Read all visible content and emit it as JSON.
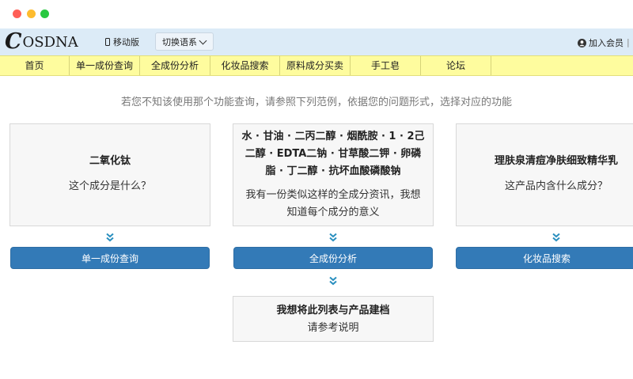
{
  "header": {
    "logo_first": "C",
    "logo_rest": "OSDNA",
    "mobile_label": "移动版",
    "lang_label": "切换语系",
    "join_label": "加入会员",
    "separator": "|"
  },
  "nav": {
    "items": [
      {
        "label": "首页"
      },
      {
        "label": "单一成份查询"
      },
      {
        "label": "全成份分析"
      },
      {
        "label": "化妆品搜索"
      },
      {
        "label": "原料成分买卖"
      },
      {
        "label": "手工皂"
      },
      {
        "label": "论坛"
      }
    ]
  },
  "intro": "若您不知该使用那个功能查询，请参照下列范例，依据您的问题形式，选择对应的功能",
  "cards": {
    "single": {
      "title": "二氧化钛",
      "question": "这个成分是什么？",
      "button": "单一成份查询"
    },
    "full": {
      "title_line1": "水 · 甘油 · 二丙二醇 · 烟酰胺 · 1 · 2己",
      "title_line2": "二醇 · EDTA二钠 · 甘草酸二钾 · 卵磷",
      "title_line3": "脂 · 丁二醇 · 抗坏血酸磷酸钠",
      "question_line1": "我有一份类似这样的全成分资讯，我想",
      "question_line2": "知道每个成分的意义",
      "button": "全成份分析"
    },
    "product": {
      "title": "理肤泉清痘净肤细致精华乳",
      "question": "这产品内含什么成分？",
      "button": "化妆品搜索"
    },
    "archive": {
      "title": "我想将此列表与产品建档",
      "link": "请参考说明"
    }
  },
  "colors": {
    "accent": "#337ab7",
    "nav_bg": "#fefc9e",
    "header_bg": "#dcebf7",
    "chevron": "#2a8fbf"
  }
}
